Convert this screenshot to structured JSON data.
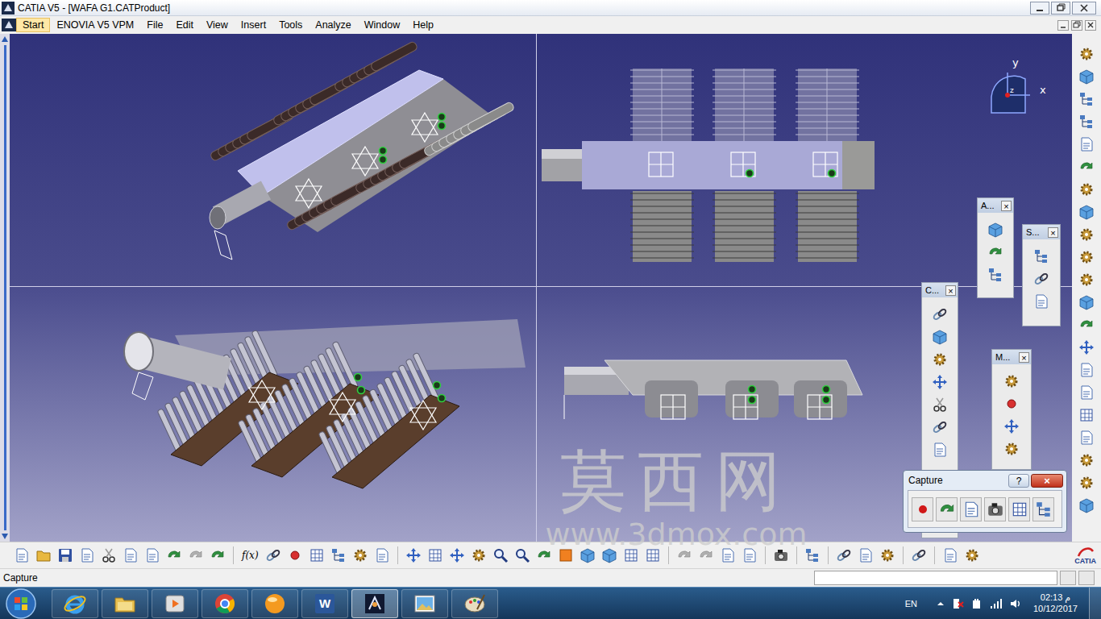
{
  "window": {
    "title": "CATIA V5 - [WAFA G1.CATProduct]"
  },
  "menu": [
    {
      "label": "Start",
      "selected": true
    },
    {
      "label": "ENOVIA V5 VPM",
      "selected": false
    },
    {
      "label": "File",
      "selected": false
    },
    {
      "label": "Edit",
      "selected": false
    },
    {
      "label": "View",
      "selected": false
    },
    {
      "label": "Insert",
      "selected": false
    },
    {
      "label": "Tools",
      "selected": false
    },
    {
      "label": "Analyze",
      "selected": false
    },
    {
      "label": "Window",
      "selected": false
    },
    {
      "label": "Help",
      "selected": false
    }
  ],
  "compass": {
    "x": "x",
    "y": "y",
    "z": "z"
  },
  "floating_toolbars": [
    {
      "title": "A...",
      "close": "×"
    },
    {
      "title": "S...",
      "close": "×"
    },
    {
      "title": "C...",
      "close": "×"
    },
    {
      "title": "M...",
      "close": "×"
    }
  ],
  "capture_toolbar": {
    "title": "Capture",
    "help": "?",
    "close": "×"
  },
  "bottom_toolbar": {
    "formula": "f(x)",
    "logo": "CATIA"
  },
  "watermark": {
    "title": "莫西网",
    "url": "www.3dmox.com"
  },
  "status_bar": {
    "text": "Capture"
  },
  "taskbar": {
    "word_letter": "W",
    "language": "EN",
    "time": "02:13 م",
    "date": "10/12/2017"
  }
}
